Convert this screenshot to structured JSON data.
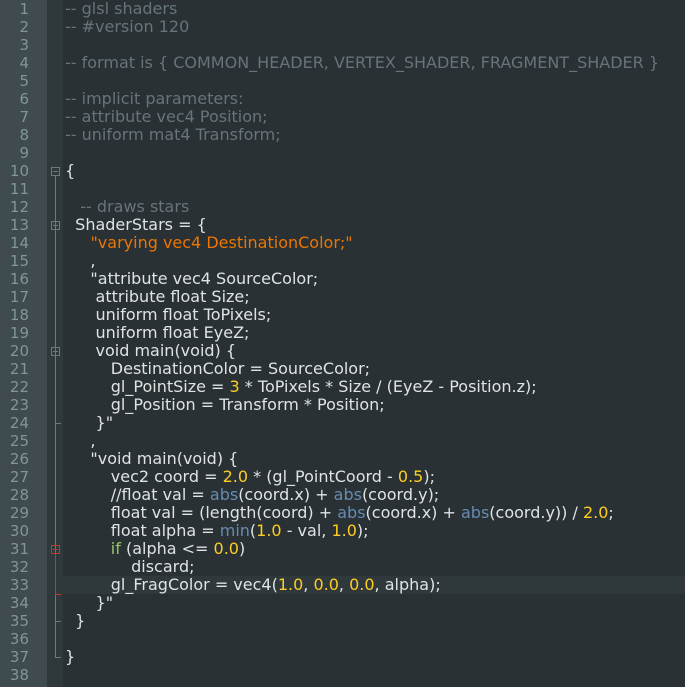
{
  "editor": {
    "language": "lua",
    "current_line": 33,
    "colors": {
      "background": "#293134",
      "gutter": "#3f4b4e",
      "line_number": "#81969a",
      "default_text": "#e0e2e4",
      "comment": "#66747b",
      "string": "#ec7600",
      "number": "#ffcd22",
      "builtin_function": "#678cb1",
      "keyword": "#93c763",
      "fold_marker": "#6c7a7d",
      "fold_marker_active": "#c0392b"
    },
    "lines": [
      {
        "n": "1",
        "tokens": [
          {
            "t": "c",
            "v": "-- glsl shaders"
          }
        ]
      },
      {
        "n": "2",
        "tokens": [
          {
            "t": "c",
            "v": "-- #version 120"
          }
        ]
      },
      {
        "n": "3",
        "tokens": []
      },
      {
        "n": "4",
        "tokens": [
          {
            "t": "c",
            "v": "-- format is { COMMON_HEADER, VERTEX_SHADER, FRAGMENT_SHADER }"
          }
        ]
      },
      {
        "n": "5",
        "tokens": []
      },
      {
        "n": "6",
        "tokens": [
          {
            "t": "c",
            "v": "-- implicit parameters:"
          }
        ]
      },
      {
        "n": "7",
        "tokens": [
          {
            "t": "c",
            "v": "-- attribute vec4 Position;"
          }
        ]
      },
      {
        "n": "8",
        "tokens": [
          {
            "t": "c",
            "v": "-- uniform mat4 Transform;"
          }
        ]
      },
      {
        "n": "9",
        "tokens": []
      },
      {
        "n": "10",
        "tokens": [
          {
            "t": "p",
            "v": "{"
          }
        ]
      },
      {
        "n": "11",
        "tokens": []
      },
      {
        "n": "12",
        "tokens": [
          {
            "t": "p",
            "v": "   "
          },
          {
            "t": "c",
            "v": "-- draws stars"
          }
        ]
      },
      {
        "n": "13",
        "tokens": [
          {
            "t": "p",
            "v": "  ShaderStars = {"
          }
        ]
      },
      {
        "n": "14",
        "tokens": [
          {
            "t": "p",
            "v": "     "
          },
          {
            "t": "s",
            "v": "\"varying vec4 DestinationColor;\""
          }
        ]
      },
      {
        "n": "15",
        "tokens": [
          {
            "t": "p",
            "v": "     ,"
          }
        ]
      },
      {
        "n": "16",
        "tokens": [
          {
            "t": "p",
            "v": "     \"attribute vec4 SourceColor;"
          }
        ]
      },
      {
        "n": "17",
        "tokens": [
          {
            "t": "p",
            "v": "      attribute float Size;"
          }
        ]
      },
      {
        "n": "18",
        "tokens": [
          {
            "t": "p",
            "v": "      uniform float ToPixels;"
          }
        ]
      },
      {
        "n": "19",
        "tokens": [
          {
            "t": "p",
            "v": "      uniform float EyeZ;"
          }
        ]
      },
      {
        "n": "20",
        "tokens": [
          {
            "t": "p",
            "v": "      void main(void) {"
          }
        ]
      },
      {
        "n": "21",
        "tokens": [
          {
            "t": "p",
            "v": "         DestinationColor = SourceColor;"
          }
        ]
      },
      {
        "n": "22",
        "tokens": [
          {
            "t": "p",
            "v": "         gl_PointSize = "
          },
          {
            "t": "n",
            "v": "3"
          },
          {
            "t": "p",
            "v": " * ToPixels * Size / (EyeZ - Position.z);"
          }
        ]
      },
      {
        "n": "23",
        "tokens": [
          {
            "t": "p",
            "v": "         gl_Position = Transform * Position;"
          }
        ]
      },
      {
        "n": "24",
        "tokens": [
          {
            "t": "p",
            "v": "      }\""
          }
        ]
      },
      {
        "n": "25",
        "tokens": [
          {
            "t": "p",
            "v": "     ,"
          }
        ]
      },
      {
        "n": "26",
        "tokens": [
          {
            "t": "p",
            "v": "     \"void main(void) {"
          }
        ]
      },
      {
        "n": "27",
        "tokens": [
          {
            "t": "p",
            "v": "         vec2 coord = "
          },
          {
            "t": "n",
            "v": "2.0"
          },
          {
            "t": "p",
            "v": " * (gl_PointCoord - "
          },
          {
            "t": "n",
            "v": "0.5"
          },
          {
            "t": "p",
            "v": ");"
          }
        ]
      },
      {
        "n": "28",
        "tokens": [
          {
            "t": "p",
            "v": "         //float val = "
          },
          {
            "t": "f",
            "v": "abs"
          },
          {
            "t": "p",
            "v": "(coord.x) + "
          },
          {
            "t": "f",
            "v": "abs"
          },
          {
            "t": "p",
            "v": "(coord.y);"
          }
        ]
      },
      {
        "n": "29",
        "tokens": [
          {
            "t": "p",
            "v": "         float val = (length(coord) + "
          },
          {
            "t": "f",
            "v": "abs"
          },
          {
            "t": "p",
            "v": "(coord.x) + "
          },
          {
            "t": "f",
            "v": "abs"
          },
          {
            "t": "p",
            "v": "(coord.y)) / "
          },
          {
            "t": "n",
            "v": "2.0"
          },
          {
            "t": "p",
            "v": ";"
          }
        ]
      },
      {
        "n": "30",
        "tokens": [
          {
            "t": "p",
            "v": "         float alpha = "
          },
          {
            "t": "f",
            "v": "min"
          },
          {
            "t": "p",
            "v": "("
          },
          {
            "t": "n",
            "v": "1.0"
          },
          {
            "t": "p",
            "v": " - val, "
          },
          {
            "t": "n",
            "v": "1.0"
          },
          {
            "t": "p",
            "v": ");"
          }
        ]
      },
      {
        "n": "31",
        "tokens": [
          {
            "t": "p",
            "v": "         "
          },
          {
            "t": "k",
            "v": "if"
          },
          {
            "t": "p",
            "v": " (alpha <= "
          },
          {
            "t": "n",
            "v": "0.0"
          },
          {
            "t": "p",
            "v": ")"
          }
        ]
      },
      {
        "n": "32",
        "tokens": [
          {
            "t": "p",
            "v": "             discard;"
          }
        ]
      },
      {
        "n": "33",
        "tokens": [
          {
            "t": "p",
            "v": "         gl_FragColor = vec4("
          },
          {
            "t": "n",
            "v": "1.0"
          },
          {
            "t": "p",
            "v": ", "
          },
          {
            "t": "n",
            "v": "0.0"
          },
          {
            "t": "p",
            "v": ", "
          },
          {
            "t": "n",
            "v": "0.0"
          },
          {
            "t": "p",
            "v": ", alpha);"
          }
        ]
      },
      {
        "n": "34",
        "tokens": [
          {
            "t": "p",
            "v": "      }\""
          }
        ]
      },
      {
        "n": "35",
        "tokens": [
          {
            "t": "p",
            "v": "  }"
          }
        ]
      },
      {
        "n": "36",
        "tokens": []
      },
      {
        "n": "37",
        "tokens": [
          {
            "t": "p",
            "v": "}"
          }
        ]
      },
      {
        "n": "38",
        "tokens": []
      }
    ],
    "fold_markers": [
      {
        "line": 10,
        "state": "expanded"
      },
      {
        "line": 13,
        "state": "expanded"
      },
      {
        "line": 20,
        "state": "expanded"
      },
      {
        "line": 31,
        "state": "active"
      }
    ]
  }
}
